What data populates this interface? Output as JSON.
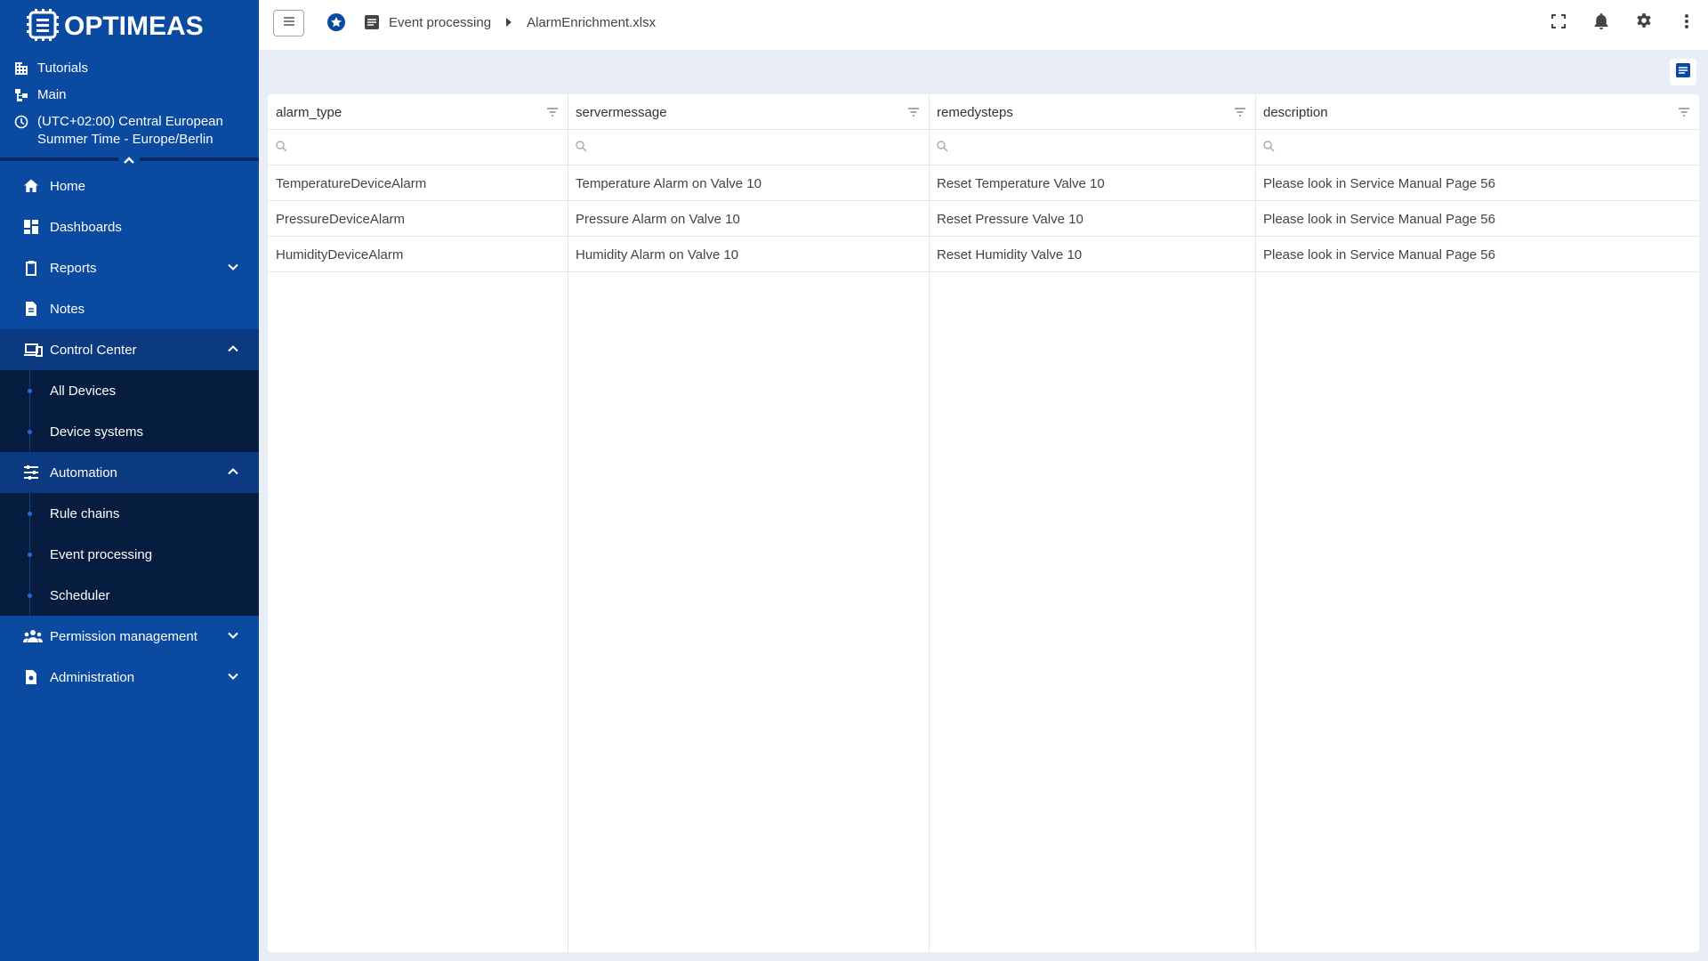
{
  "brand": {
    "logo_text": "OPTIMEAS"
  },
  "context": {
    "tutorials_label": "Tutorials",
    "main_label": "Main",
    "timezone_label": "(UTC+02:00) Central European Summer Time - Europe/Berlin"
  },
  "sidebar": {
    "home": "Home",
    "dashboards": "Dashboards",
    "reports": "Reports",
    "notes": "Notes",
    "control_center": "Control Center",
    "all_devices": "All Devices",
    "device_systems": "Device systems",
    "automation": "Automation",
    "rule_chains": "Rule chains",
    "event_processing": "Event processing",
    "scheduler": "Scheduler",
    "permission_management": "Permission management",
    "administration": "Administration"
  },
  "breadcrumb": {
    "section": "Event processing",
    "file": "AlarmEnrichment.xlsx"
  },
  "table": {
    "columns": [
      "alarm_type",
      "servermessage",
      "remedysteps",
      "description"
    ],
    "rows": [
      [
        "TemperatureDeviceAlarm",
        "Temperature Alarm on Valve 10",
        "Reset Temperature Valve 10",
        "Please look in Service Manual Page 56"
      ],
      [
        "PressureDeviceAlarm",
        "Pressure Alarm on Valve 10",
        "Reset Pressure Valve 10",
        "Please look in Service Manual Page 56"
      ],
      [
        "HumidityDeviceAlarm",
        "Humidity Alarm on Valve 10",
        "Reset Humidity Valve 10",
        "Please look in Service Manual Page 56"
      ]
    ]
  },
  "icons": {
    "top_right": [
      "fullscreen-icon",
      "bell-icon",
      "gear-icon",
      "more-vert-icon"
    ]
  },
  "colors": {
    "sidebar_bg": "#0a4aa0",
    "sidebar_sub_bg": "#061d3f",
    "page_bg": "#e9eef6"
  }
}
